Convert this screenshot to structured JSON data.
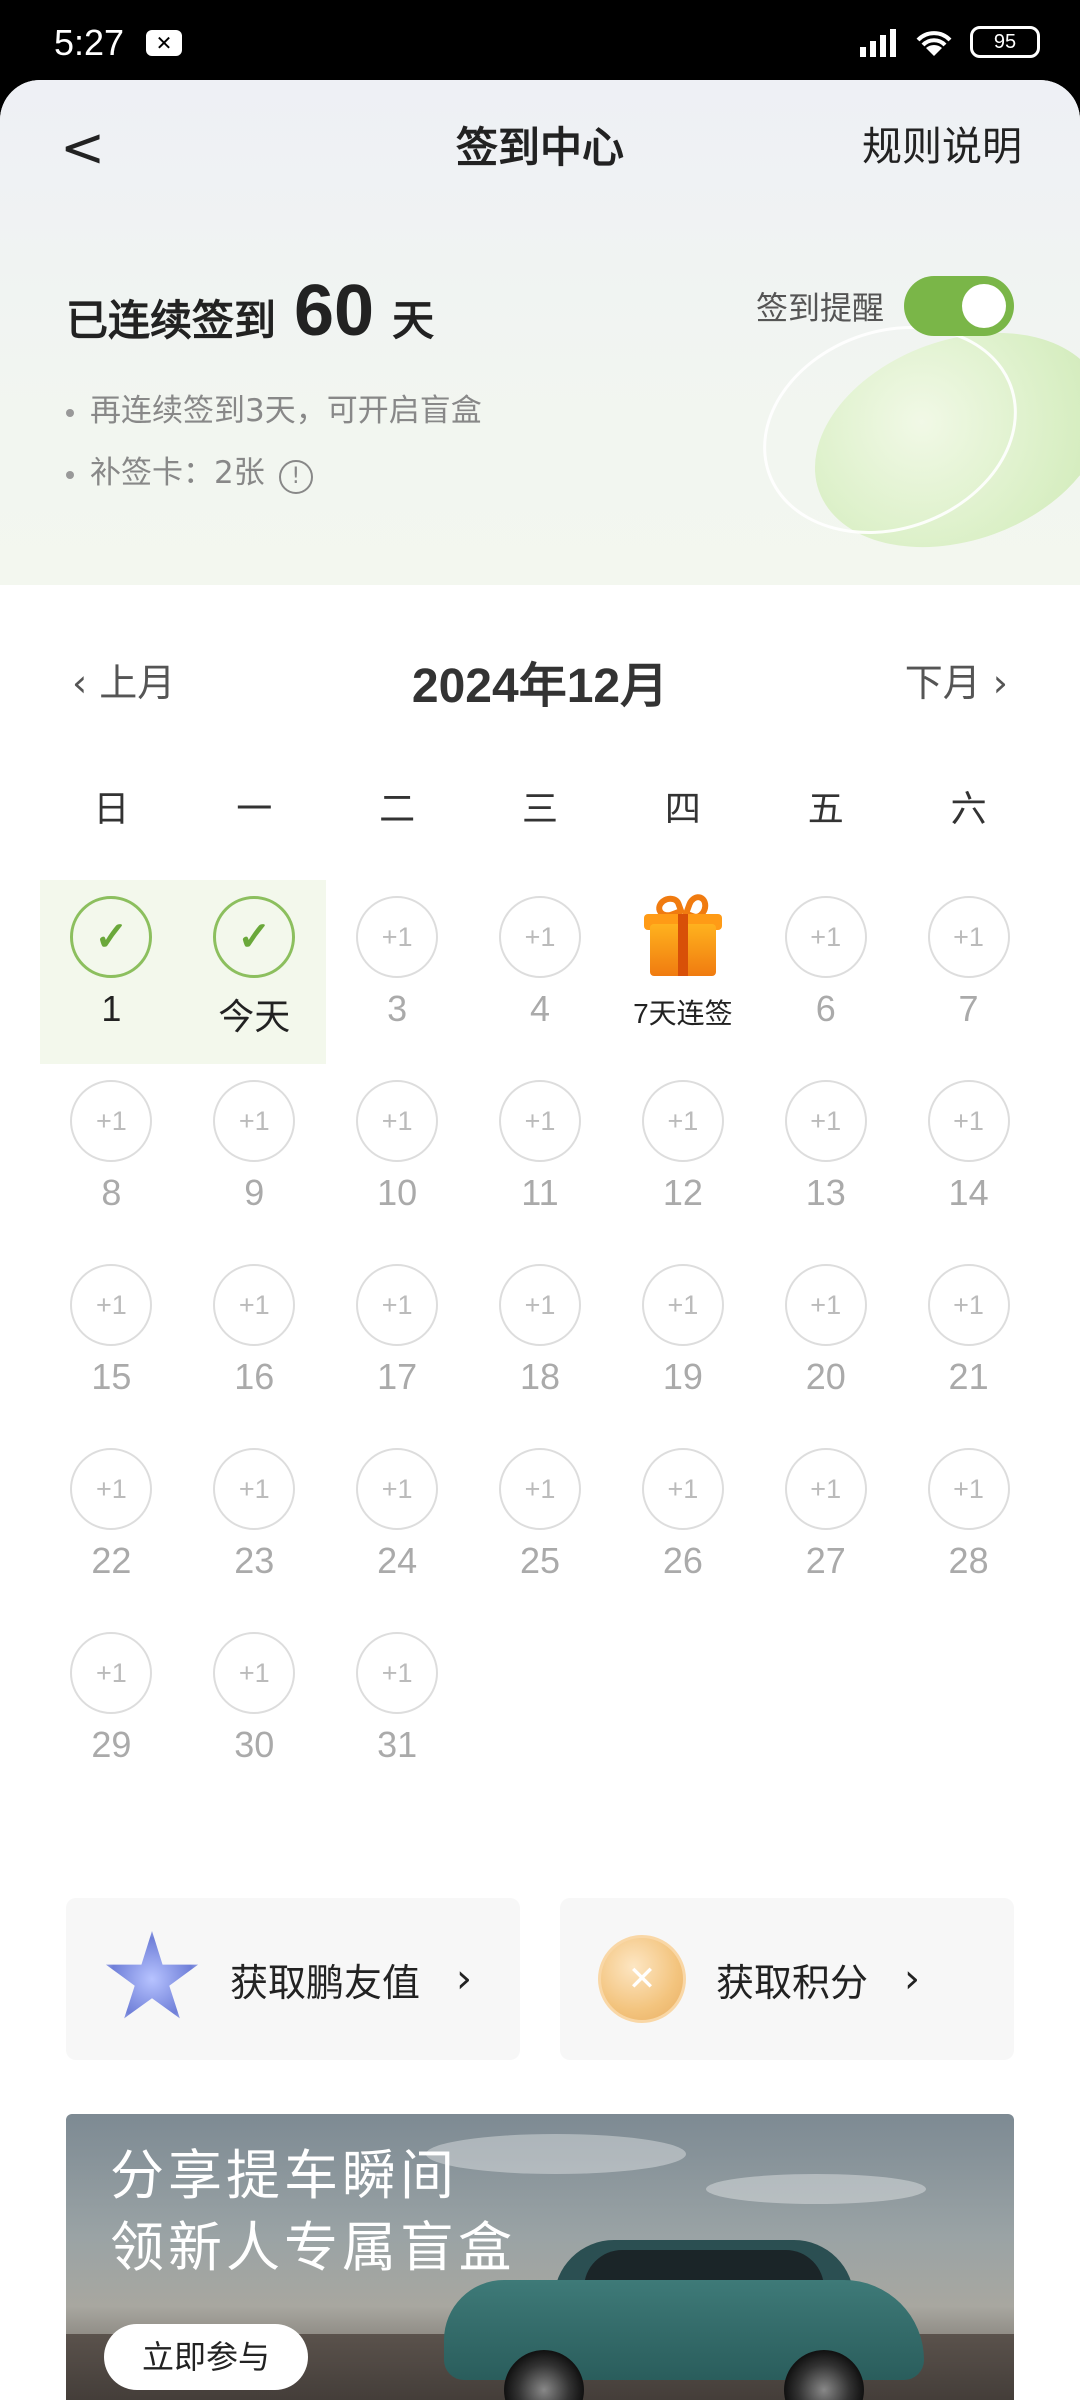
{
  "status": {
    "time": "5:27",
    "battery": "95"
  },
  "nav": {
    "back": "<",
    "title": "签到中心",
    "rules": "规则说明"
  },
  "streak": {
    "prefix": "已连续签到",
    "days": "60",
    "suffix": "天"
  },
  "reminder": {
    "label": "签到提醒",
    "on": true
  },
  "tips": [
    "再连续签到3天，可开启盲盒",
    "补签卡：2张"
  ],
  "month": {
    "prev": "上月",
    "title": "2024年12月",
    "next": "下月"
  },
  "weekdays": [
    "日",
    "一",
    "二",
    "三",
    "四",
    "五",
    "六"
  ],
  "calendar": [
    {
      "label": "1",
      "state": "checked"
    },
    {
      "label": "今天",
      "state": "checked"
    },
    {
      "label": "3",
      "state": "plus"
    },
    {
      "label": "4",
      "state": "plus"
    },
    {
      "label": "7天连签",
      "state": "gift"
    },
    {
      "label": "6",
      "state": "plus"
    },
    {
      "label": "7",
      "state": "plus"
    },
    {
      "label": "8",
      "state": "plus"
    },
    {
      "label": "9",
      "state": "plus"
    },
    {
      "label": "10",
      "state": "plus"
    },
    {
      "label": "11",
      "state": "plus"
    },
    {
      "label": "12",
      "state": "plus"
    },
    {
      "label": "13",
      "state": "plus"
    },
    {
      "label": "14",
      "state": "plus"
    },
    {
      "label": "15",
      "state": "plus"
    },
    {
      "label": "16",
      "state": "plus"
    },
    {
      "label": "17",
      "state": "plus"
    },
    {
      "label": "18",
      "state": "plus"
    },
    {
      "label": "19",
      "state": "plus"
    },
    {
      "label": "20",
      "state": "plus"
    },
    {
      "label": "21",
      "state": "plus"
    },
    {
      "label": "22",
      "state": "plus"
    },
    {
      "label": "23",
      "state": "plus"
    },
    {
      "label": "24",
      "state": "plus"
    },
    {
      "label": "25",
      "state": "plus"
    },
    {
      "label": "26",
      "state": "plus"
    },
    {
      "label": "27",
      "state": "plus"
    },
    {
      "label": "28",
      "state": "plus"
    },
    {
      "label": "29",
      "state": "plus"
    },
    {
      "label": "30",
      "state": "plus"
    },
    {
      "label": "31",
      "state": "plus"
    }
  ],
  "plus_text": "+1",
  "check_text": "✓",
  "actions": {
    "friend_value": "获取鹏友值",
    "points": "获取积分"
  },
  "banner": {
    "line1": "分享提车瞬间",
    "line2": "领新人专属盲盒",
    "cta": "立即参与"
  },
  "colors": {
    "accent": "#7ab648",
    "check": "#8cbf5e"
  }
}
